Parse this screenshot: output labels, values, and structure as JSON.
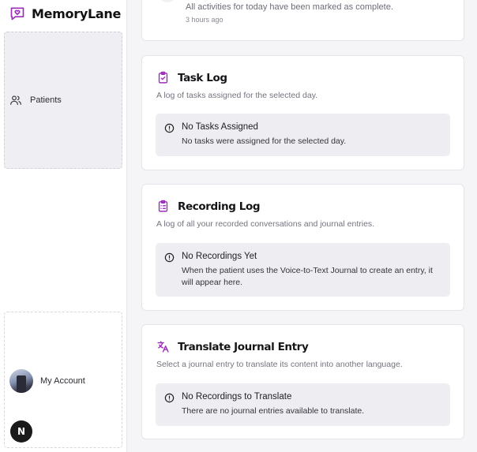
{
  "app": {
    "name": "MemoryLane",
    "accent": "#9c2fb8"
  },
  "sidebar": {
    "nav": [
      {
        "label": "Patients",
        "icon": "users-icon"
      }
    ],
    "account_label": "My Account",
    "badge_letter": "N"
  },
  "activity": {
    "text": "All activities for today have been marked as complete.",
    "time": "3 hours ago"
  },
  "task_log": {
    "title": "Task Log",
    "subtitle": "A log of tasks assigned for the selected day.",
    "notice_title": "No Tasks Assigned",
    "notice_body": "No tasks were assigned for the selected day."
  },
  "recording_log": {
    "title": "Recording Log",
    "subtitle": "A log of all your recorded conversations and journal entries.",
    "notice_title": "No Recordings Yet",
    "notice_body": "When the patient uses the Voice-to-Text Journal to create an entry, it will appear here."
  },
  "translate": {
    "title": "Translate Journal Entry",
    "subtitle": "Select a journal entry to translate its content into another language.",
    "notice_title": "No Recordings to Translate",
    "notice_body": "There are no journal entries available to translate."
  }
}
